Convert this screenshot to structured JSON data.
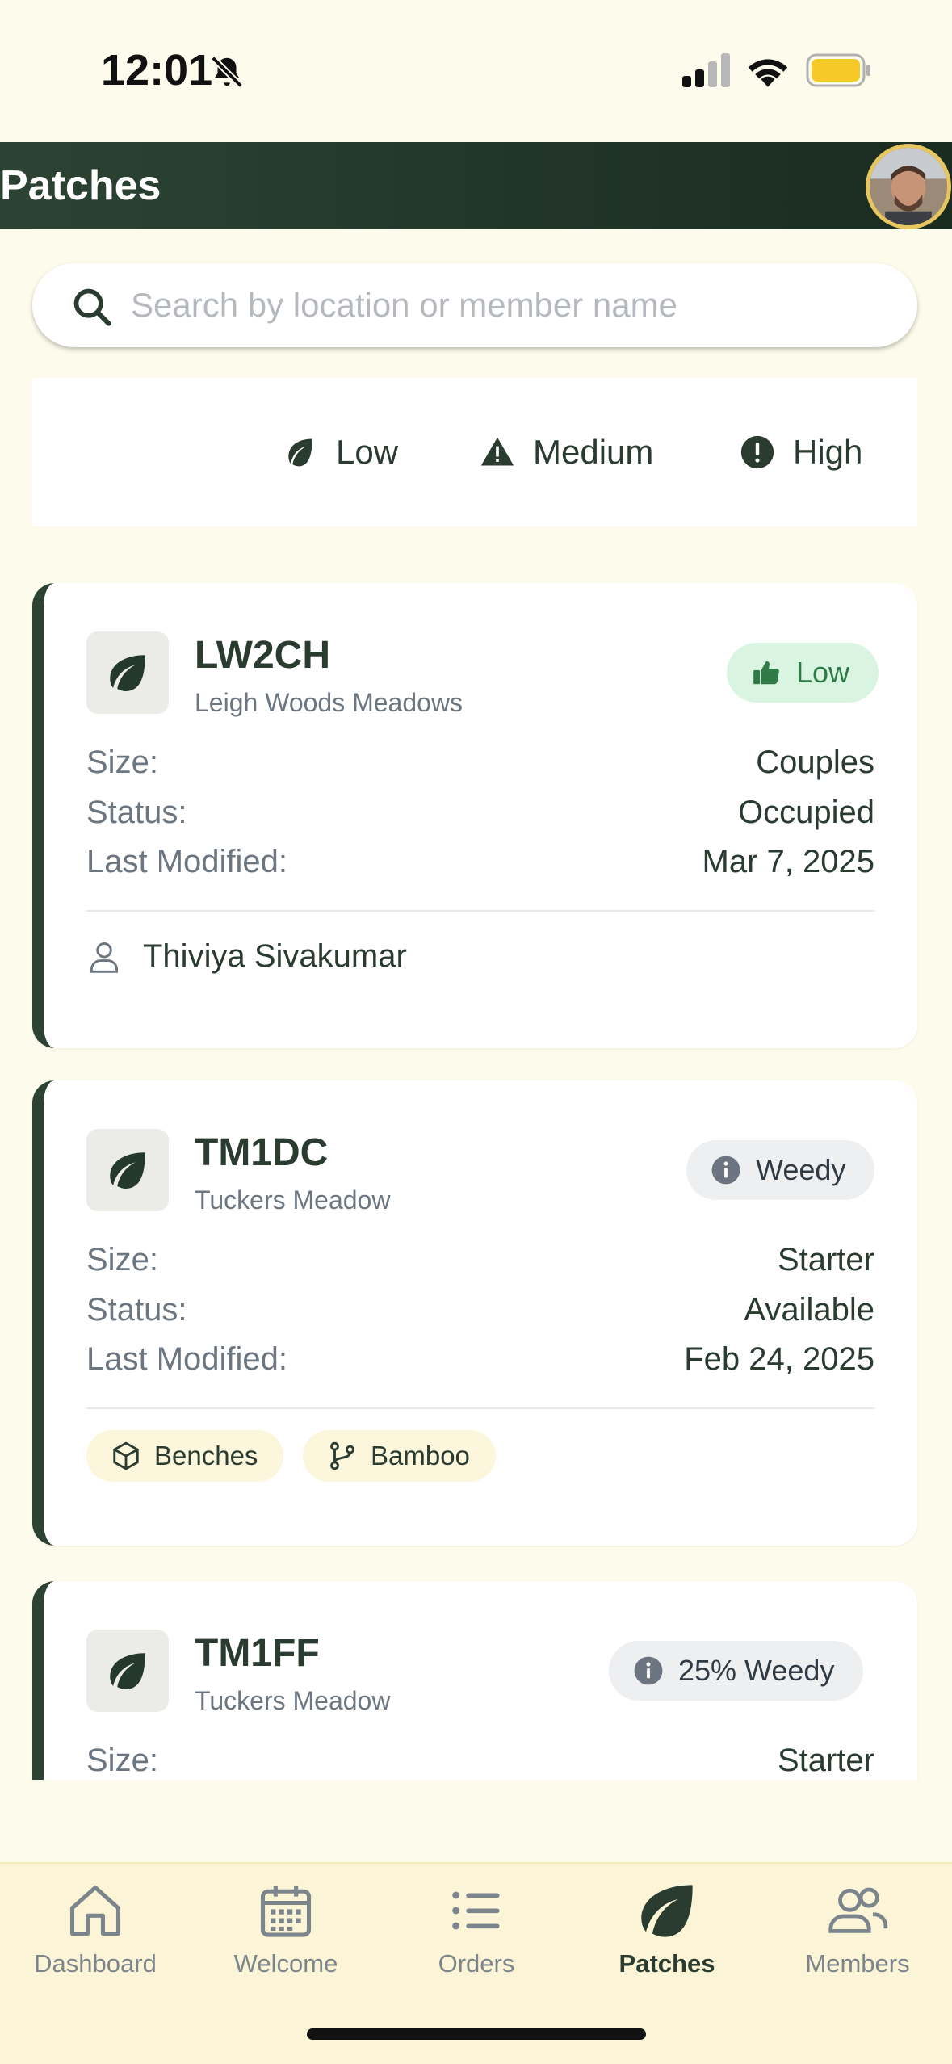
{
  "status_bar": {
    "time": "12:01"
  },
  "header": {
    "title": "Patches"
  },
  "search": {
    "placeholder": "Search by location or member name",
    "value": ""
  },
  "filters": [
    {
      "label": "Low",
      "icon": "leaf-icon"
    },
    {
      "label": "Medium",
      "icon": "warning-triangle-icon"
    },
    {
      "label": "High",
      "icon": "exclamation-circle-icon"
    }
  ],
  "field_labels": {
    "size": "Size:",
    "status": "Status:",
    "last_modified": "Last Modified:"
  },
  "patches": [
    {
      "code": "LW2CH",
      "location": "Leigh Woods Meadows",
      "badge": {
        "label": "Low",
        "icon": "thumbs-up-icon",
        "color": "#2f7a47",
        "bg": "#d9f5e2"
      },
      "size": "Couples",
      "status": "Occupied",
      "last_modified": "Mar 7, 2025",
      "member": "Thiviya Sivakumar"
    },
    {
      "code": "TM1DC",
      "location": "Tuckers Meadow",
      "badge": {
        "label": "Weedy",
        "icon": "info-icon",
        "color": "#2f3a44",
        "bg": "#eeeff1"
      },
      "size": "Starter",
      "status": "Available",
      "last_modified": "Feb 24, 2025",
      "tags": [
        {
          "label": "Benches",
          "icon": "cube-icon"
        },
        {
          "label": "Bamboo",
          "icon": "branch-icon"
        }
      ]
    },
    {
      "code": "TM1FF",
      "location": "Tuckers Meadow",
      "badge": {
        "label": "25% Weedy",
        "icon": "info-icon",
        "color": "#2f3a44",
        "bg": "#eeeff1"
      },
      "size": "Starter"
    }
  ],
  "tabs": [
    {
      "label": "Dashboard",
      "icon": "home-icon",
      "active": false
    },
    {
      "label": "Welcome",
      "icon": "calendar-icon",
      "active": false
    },
    {
      "label": "Orders",
      "icon": "list-icon",
      "active": false
    },
    {
      "label": "Patches",
      "icon": "leaf-icon",
      "active": true
    },
    {
      "label": "Members",
      "icon": "members-icon",
      "active": false
    }
  ],
  "colors": {
    "brand_dark": "#2c4333",
    "background": "#fdfcec",
    "tab_bar": "#fbf4d6",
    "avatar_ring": "#e7c660"
  }
}
